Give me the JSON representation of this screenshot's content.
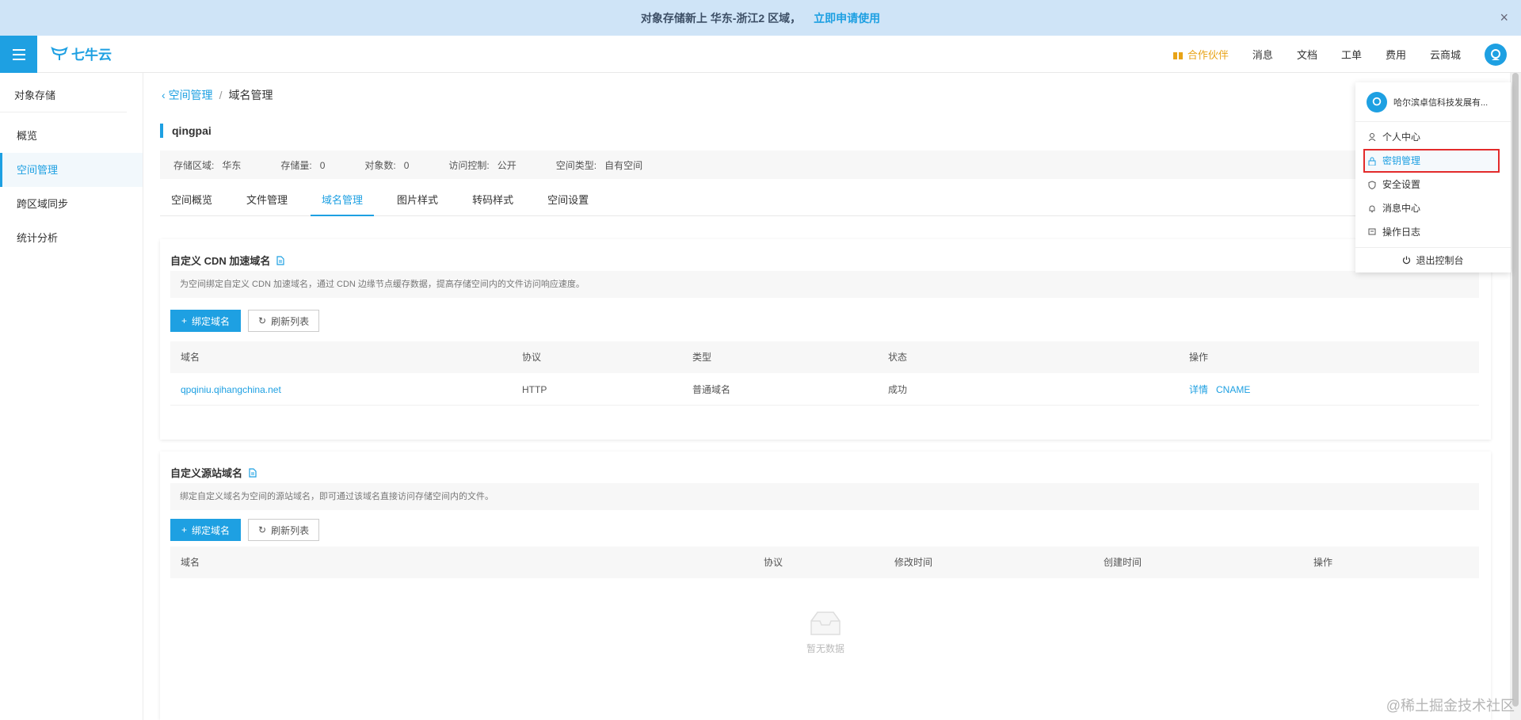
{
  "banner": {
    "text": "对象存储新上 华东-浙江2 区域，",
    "link": "立即申请使用",
    "close": "×"
  },
  "topbar": {
    "logo_text": "七牛云",
    "nav": [
      "合作伙伴",
      "消息",
      "文档",
      "工单",
      "费用",
      "云商城"
    ]
  },
  "sidebar": {
    "title": "对象存储",
    "items": [
      {
        "label": "概览",
        "active": false
      },
      {
        "label": "空间管理",
        "active": true
      },
      {
        "label": "跨区域同步",
        "active": false
      },
      {
        "label": "统计分析",
        "active": false
      }
    ]
  },
  "breadcrumb": {
    "back": "空间管理",
    "sep": "/",
    "current": "域名管理"
  },
  "bucket": {
    "name": "qingpai"
  },
  "info": [
    {
      "label": "存储区域:",
      "value": "华东"
    },
    {
      "label": "存储量:",
      "value": "0"
    },
    {
      "label": "对象数:",
      "value": "0"
    },
    {
      "label": "访问控制:",
      "value": "公开"
    },
    {
      "label": "空间类型:",
      "value": "自有空间"
    }
  ],
  "tabs": [
    "空间概览",
    "文件管理",
    "域名管理",
    "图片样式",
    "转码样式",
    "空间设置"
  ],
  "active_tab": "域名管理",
  "cdn_card": {
    "title": "自定义 CDN 加速域名",
    "desc": "为空间绑定自定义 CDN 加速域名，通过 CDN 边缘节点缓存数据，提高存储空间内的文件访问响应速度。",
    "bind_label": "绑定域名",
    "refresh_label": "刷新列表",
    "columns": [
      "域名",
      "协议",
      "类型",
      "状态",
      "操作"
    ],
    "rows": [
      {
        "domain": "qpqiniu.qihangchina.net",
        "protocol": "HTTP",
        "type": "普通域名",
        "status": "成功",
        "action1": "详情",
        "action2": "CNAME"
      }
    ]
  },
  "origin_card": {
    "title": "自定义源站域名",
    "desc": "绑定自定义域名为空间的源站域名，即可通过该域名直接访问存储空间内的文件。",
    "bind_label": "绑定域名",
    "refresh_label": "刷新列表",
    "columns": [
      "域名",
      "协议",
      "修改时间",
      "创建时间",
      "操作"
    ],
    "empty_text": "暂无数据"
  },
  "dropdown": {
    "company": "哈尔滨卓信科技发展有...",
    "items": [
      "个人中心",
      "密钥管理",
      "安全设置",
      "消息中心",
      "操作日志"
    ],
    "highlighted": "密钥管理",
    "logout": "退出控制台"
  },
  "watermark": "@稀土掘金技术社区",
  "colors": {
    "accent": "#1ea0e2",
    "highlight_border": "#e32b2b",
    "partner": "#e8a317"
  }
}
